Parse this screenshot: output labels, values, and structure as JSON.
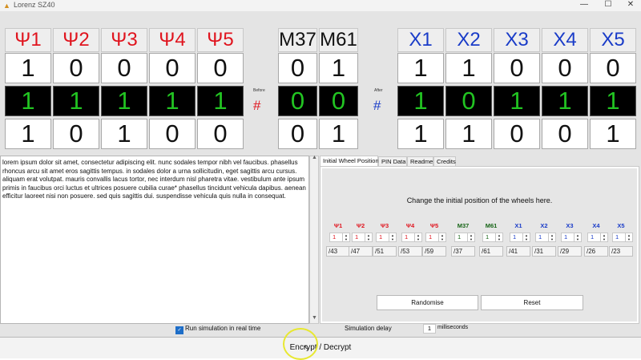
{
  "window": {
    "title": "Lorenz SZ40",
    "controls": [
      "—",
      "☐",
      "✕"
    ]
  },
  "chi": {
    "headers": [
      "Ψ1",
      "Ψ2",
      "Ψ3",
      "Ψ4",
      "Ψ5"
    ],
    "top": [
      "1",
      "0",
      "0",
      "0",
      "0"
    ],
    "mid": [
      "1",
      "1",
      "1",
      "1",
      "1"
    ],
    "bottom": [
      "1",
      "0",
      "1",
      "0",
      "0"
    ]
  },
  "motor": {
    "headers": [
      "M37",
      "M61"
    ],
    "top": [
      "0",
      "1"
    ],
    "mid": [
      "0",
      "0"
    ],
    "bottom": [
      "0",
      "1"
    ]
  },
  "psi": {
    "headers": [
      "X1",
      "X2",
      "X3",
      "X4",
      "X5"
    ],
    "top": [
      "1",
      "1",
      "0",
      "0",
      "0"
    ],
    "mid": [
      "1",
      "0",
      "1",
      "1",
      "1"
    ],
    "bottom": [
      "1",
      "1",
      "0",
      "0",
      "1"
    ]
  },
  "labels": {
    "before": "Before",
    "after": "After",
    "hash_left": "#",
    "hash_right": "#"
  },
  "log_text": "lorem ipsum dolor sit amet, consectetur adipiscing elit. nunc sodales tempor nibh vel faucibus. phasellus rhoncus arcu sit amet eros sagittis tempus. in sodales dolor a urna sollicitudin, eget sagittis arcu cursus. aliquam erat volutpat. mauris convallis lacus tortor, nec interdum nisl pharetra vitae. vestibulum ante ipsum primis in faucibus orci luctus et ultrices posuere cubilia curae* phasellus tincidunt vehicula dapibus. aenean efficitur laoreet nisi non posuere. sed quis sagittis dui. suspendisse vehicula quis nulla in consequat.",
  "tabs": [
    "Initial Wheel Positions",
    "PIN Data",
    "Readme",
    "Credits"
  ],
  "panel": {
    "instruction": "Change the initial position of the wheels here.",
    "wheels": [
      {
        "label": "Ψ1",
        "color": "#e0141e",
        "position": "1",
        "size": "/43"
      },
      {
        "label": "Ψ2",
        "color": "#e0141e",
        "position": "1",
        "size": "/47"
      },
      {
        "label": "Ψ3",
        "color": "#e0141e",
        "position": "1",
        "size": "/51"
      },
      {
        "label": "Ψ4",
        "color": "#e0141e",
        "position": "1",
        "size": "/53"
      },
      {
        "label": "Ψ5",
        "color": "#e0141e",
        "position": "1",
        "size": "/59"
      },
      {
        "label": "M37",
        "color": "#166416",
        "position": "1",
        "size": "/37"
      },
      {
        "label": "M61",
        "color": "#166416",
        "position": "1",
        "size": "/61"
      },
      {
        "label": "X1",
        "color": "#1a3cc8",
        "position": "1",
        "size": "/41"
      },
      {
        "label": "X2",
        "color": "#1a3cc8",
        "position": "1",
        "size": "/31"
      },
      {
        "label": "X3",
        "color": "#1a3cc8",
        "position": "1",
        "size": "/29"
      },
      {
        "label": "X4",
        "color": "#1a3cc8",
        "position": "1",
        "size": "/26"
      },
      {
        "label": "X5",
        "color": "#1a3cc8",
        "position": "1",
        "size": "/23"
      }
    ],
    "randomise_label": "Randomise",
    "reset_label": "Reset"
  },
  "footer": {
    "sim_checkbox_label": "Run simulation in real time",
    "sim_checked": true,
    "delay_label": "Simulation delay",
    "delay_value": "1",
    "delay_unit": "milliseconds",
    "encrypt_label": "Encrypt / Decrypt"
  }
}
